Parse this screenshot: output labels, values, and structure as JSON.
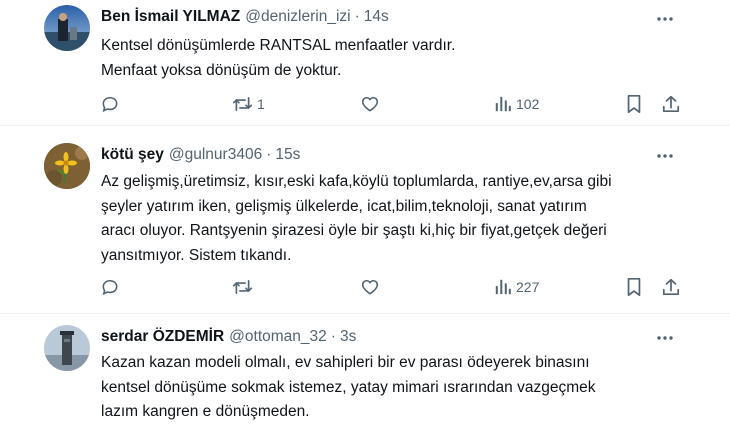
{
  "tweets": [
    {
      "name": "Ben İsmail YILMAZ",
      "handle": "@denizlerin_izi",
      "separator": "·",
      "time": "14s",
      "lines": [
        "Kentsel dönüşümlerde RANTSAL menfaatler vardır.",
        "Menfaat yoksa dönüşüm de yoktur."
      ],
      "retweets": "1",
      "views": "102"
    },
    {
      "name": "kötü şey",
      "handle": "@gulnur3406",
      "separator": "·",
      "time": "15s",
      "lines": [
        "Az gelişmiş,üretimsiz, kısır,eski kafa,köylü toplumlarda, rantiye,ev,arsa gibi",
        "şeyler yatırım iken, gelişmiş ülkelerde, icat,bilim,teknoloji, sanat yatırım",
        "aracı oluyor. Rantşyenin şirazesi  öyle bir şaştı ki,hiç bir fiyat,getçek değeri",
        "yansıtmıyor. Sistem tıkandı."
      ],
      "retweets": "",
      "views": "227"
    },
    {
      "name": "serdar ÖZDEMİR",
      "handle": "@ottoman_32",
      "separator": "·",
      "time": "3s",
      "lines": [
        "Kazan kazan modeli olmalı, ev sahipleri bir ev parası ödeyerek binasını",
        "kentsel dönüşüme sokmak istemez, yatay mimari ısrarından vazgeçmek",
        "lazım kangren e dönüşmeden."
      ]
    }
  ],
  "colors": {
    "text": "#0f1419",
    "secondary": "#536471",
    "divider": "#eff3f4"
  },
  "icons": [
    "more-icon",
    "reply-icon",
    "retweet-icon",
    "like-icon",
    "views-icon",
    "bookmark-icon",
    "share-icon"
  ]
}
